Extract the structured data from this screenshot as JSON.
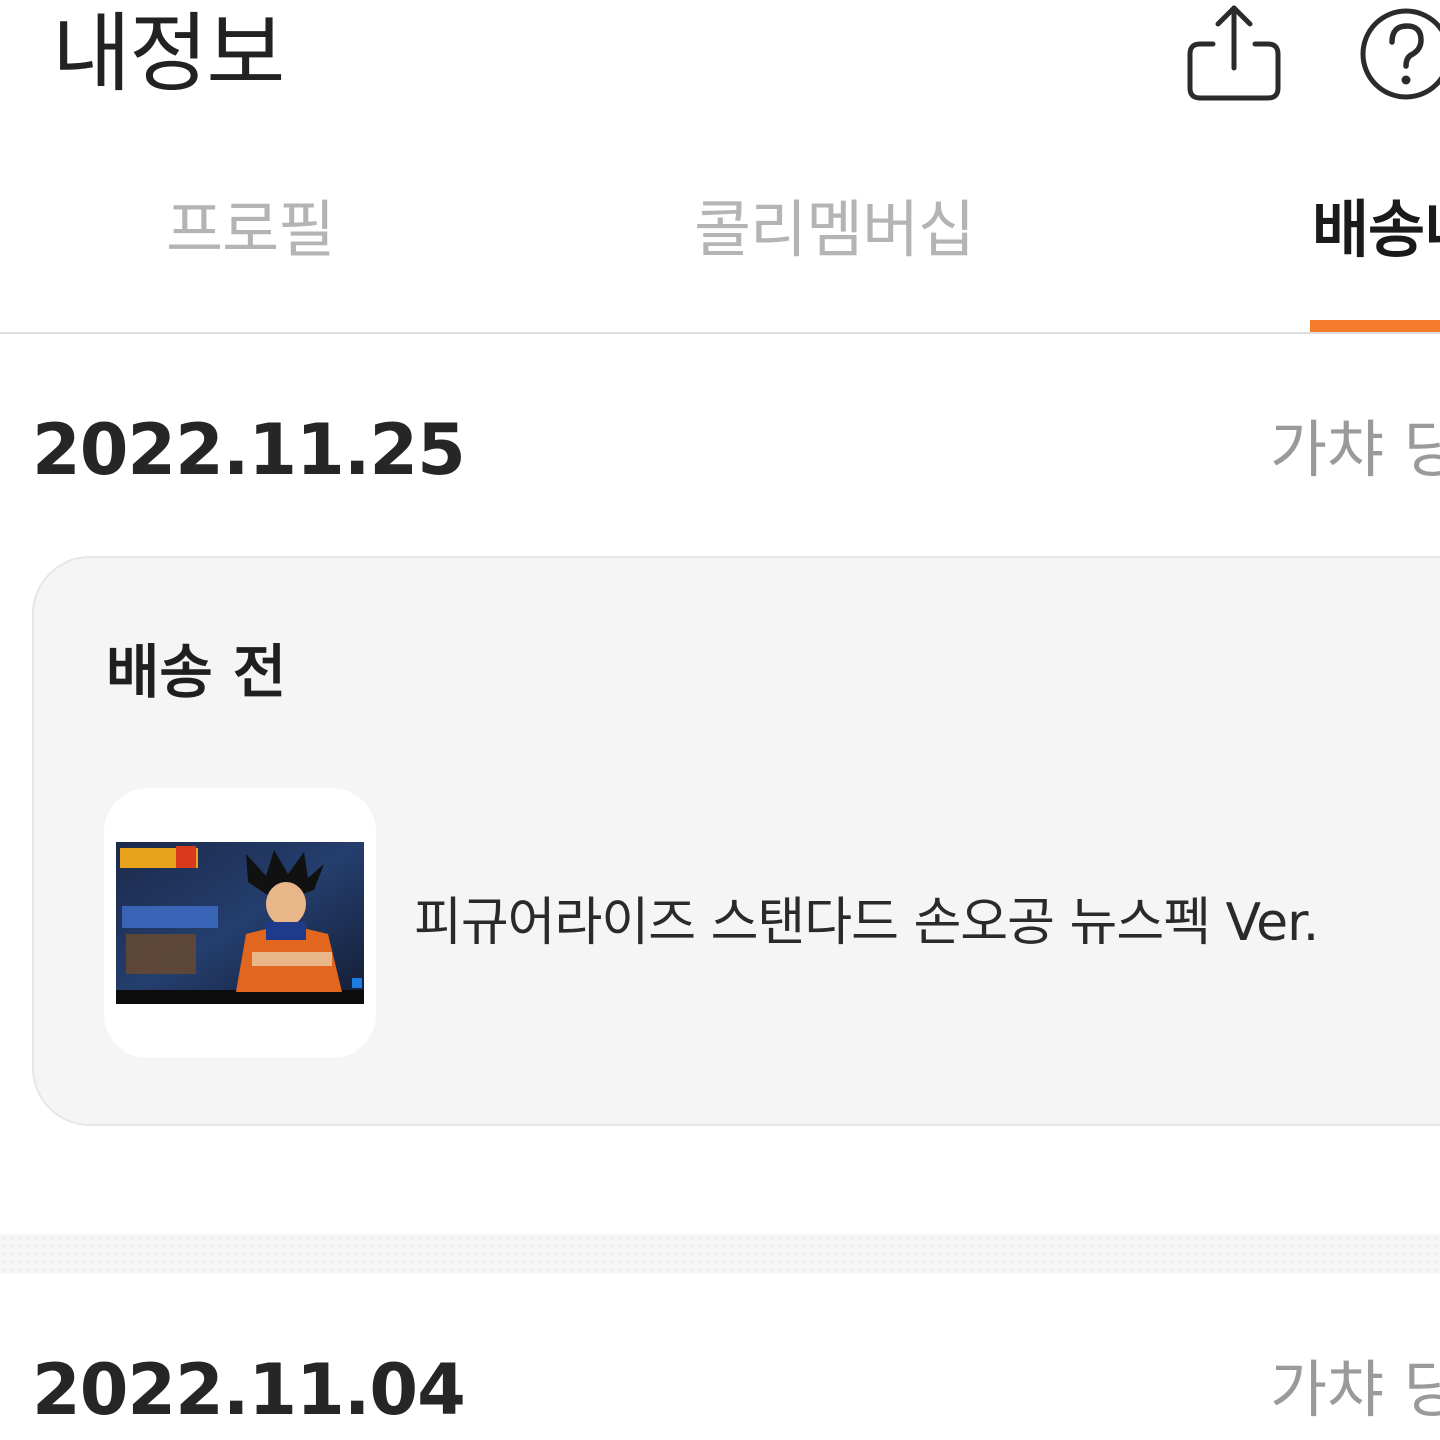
{
  "header": {
    "title": "내정보",
    "share_icon": "share-icon",
    "help_icon": "help-icon"
  },
  "tabs": [
    {
      "label": "프로필",
      "active": false
    },
    {
      "label": "콜리멤버십",
      "active": false
    },
    {
      "label": "배송내역",
      "active": true
    }
  ],
  "accent_color": "#f47a2c",
  "orders": [
    {
      "date": "2022.11.25",
      "category": "가챠 당첨",
      "status": "배송 전",
      "item_name": "피규어라이즈 스탠다드 손오공 뉴스펙 Ver."
    },
    {
      "date": "2022.11.04",
      "category": "가챠 당첨"
    }
  ]
}
